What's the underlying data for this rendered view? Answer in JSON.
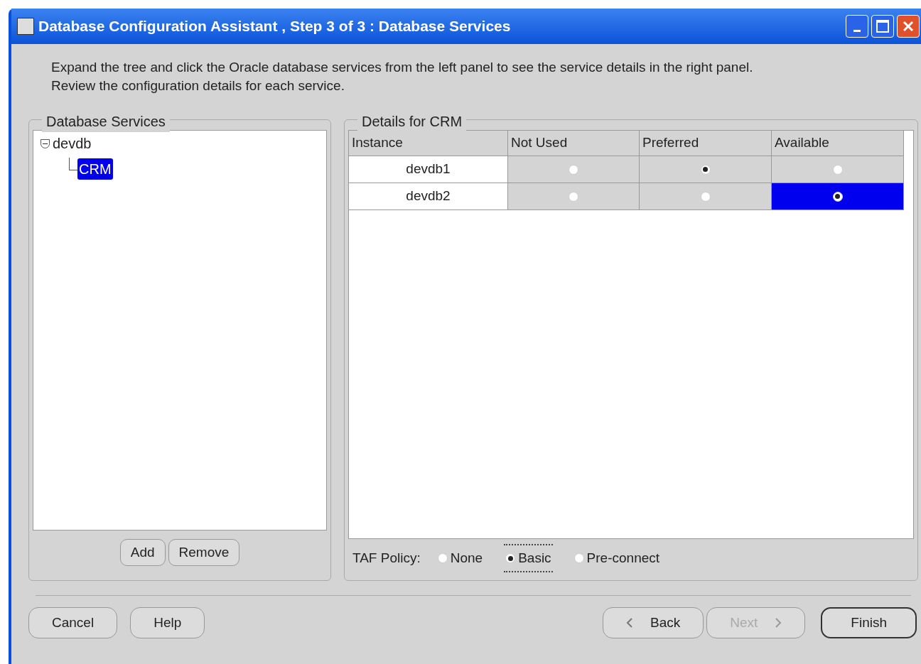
{
  "window": {
    "title": "Database Configuration Assistant , Step 3 of 3 : Database Services"
  },
  "instructions": [
    "Expand the tree and click the Oracle database services from the left panel to see the service details in the right panel.",
    "Review the configuration details for each service."
  ],
  "services_panel": {
    "title": "Database Services",
    "tree": [
      {
        "label": "devdb",
        "expanded": true,
        "selected": false,
        "children": [
          {
            "label": "CRM",
            "selected": true
          }
        ]
      }
    ],
    "buttons": [
      "Add",
      "Remove"
    ]
  },
  "details_panel": {
    "title": "Details for CRM",
    "columns": [
      "Instance",
      "Not Used",
      "Preferred",
      "Available"
    ],
    "rows": [
      {
        "instance": "devdb1",
        "choices": [
          {
            "selected": false,
            "focused": false
          },
          {
            "selected": true,
            "focused": false
          },
          {
            "selected": false,
            "focused": false
          }
        ]
      },
      {
        "instance": "devdb2",
        "choices": [
          {
            "selected": false,
            "focused": false
          },
          {
            "selected": false,
            "focused": false
          },
          {
            "selected": true,
            "focused": true
          }
        ]
      }
    ],
    "taf_policy": {
      "label": "TAF Policy:",
      "options": [
        {
          "label": "None",
          "selected": false,
          "focused": false
        },
        {
          "label": "Basic",
          "selected": true,
          "focused": true
        },
        {
          "label": "Pre-connect",
          "selected": false,
          "focused": false
        }
      ]
    }
  },
  "footer": {
    "left_buttons": [
      {
        "label": "Cancel",
        "disabled": false
      },
      {
        "label": "Help",
        "disabled": false
      }
    ],
    "right_buttons": [
      {
        "label": "Back",
        "disabled": false,
        "kind": "back"
      },
      {
        "label": "Next",
        "disabled": true,
        "kind": "next"
      },
      {
        "label": "Finish",
        "disabled": false,
        "kind": "finish"
      }
    ]
  }
}
